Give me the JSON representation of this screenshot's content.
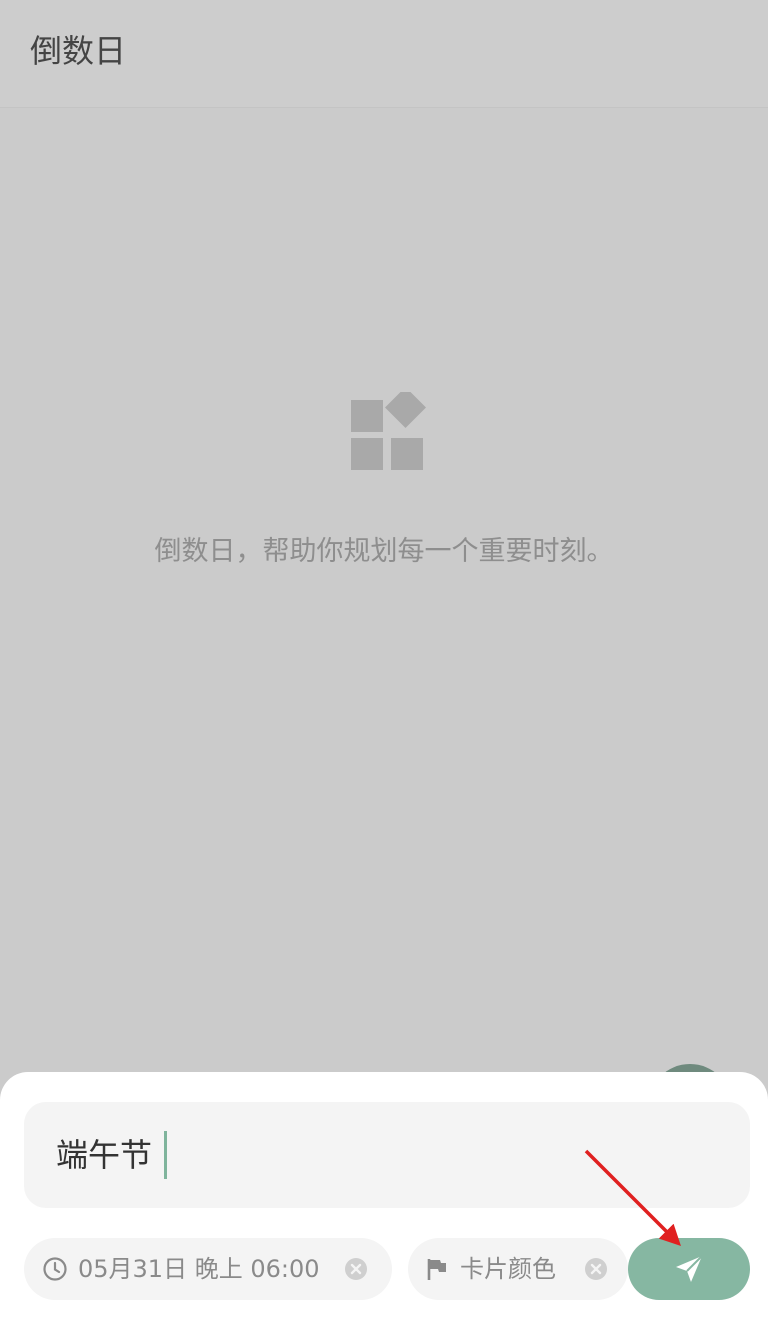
{
  "appbar": {
    "title": "倒数日"
  },
  "empty_state": {
    "icon": "widgets-icon",
    "message": "倒数日，帮助你规划每一个重要时刻。"
  },
  "sheet": {
    "title_input": {
      "value": "端午节"
    },
    "date_chip": {
      "icon": "clock-icon",
      "label": "05月31日 晚上 06:00",
      "clear_icon": "clear-icon"
    },
    "color_chip": {
      "icon": "flag-icon",
      "label": "卡片颜色",
      "clear_icon": "clear-icon"
    },
    "send_button": {
      "icon": "send-icon"
    }
  },
  "colors": {
    "scrim": "#cbcbcb",
    "accent": "#86b7a2",
    "caret": "#7fb49c",
    "annotation": "#e02020"
  }
}
